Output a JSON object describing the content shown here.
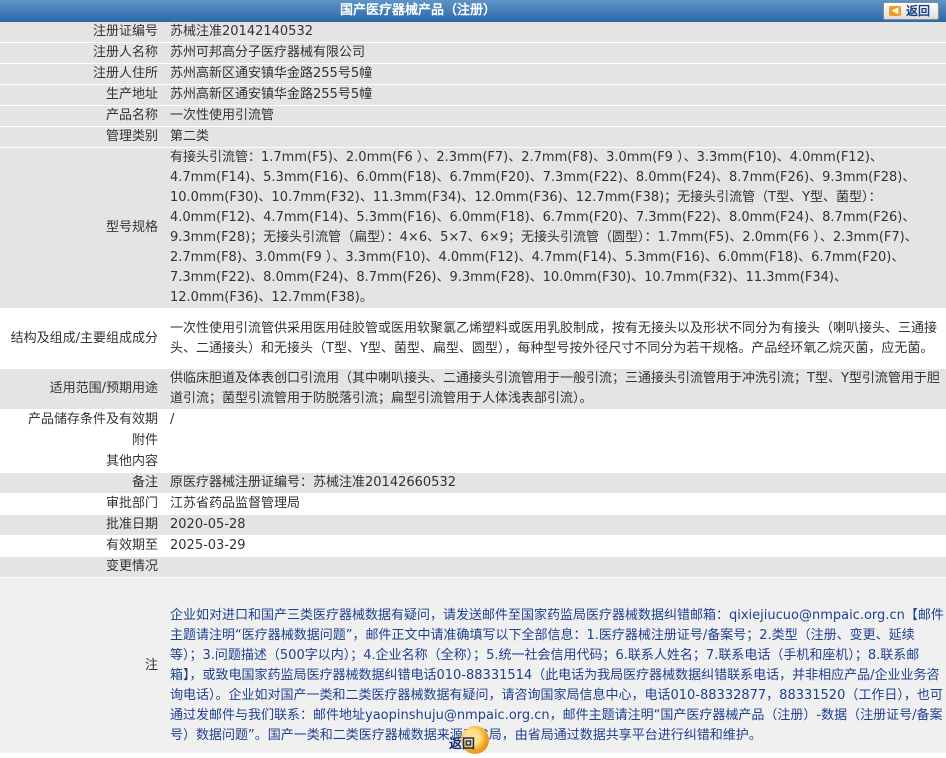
{
  "header": {
    "title": "国产医疗器械产品（注册）",
    "back_label": "返回"
  },
  "rows": [
    {
      "label": "注册证编号",
      "value": "苏械注准20142140532"
    },
    {
      "label": "注册人名称",
      "value": "苏州可邦高分子医疗器械有限公司"
    },
    {
      "label": "注册人住所",
      "value": "苏州高新区通安镇华金路255号5幢"
    },
    {
      "label": "生产地址",
      "value": "苏州高新区通安镇华金路255号5幢"
    },
    {
      "label": "产品名称",
      "value": "一次性使用引流管"
    },
    {
      "label": "管理类别",
      "value": "第二类"
    },
    {
      "label": "型号规格",
      "value": "有接头引流管：1.7mm(F5)、2.0mm(F6 ）、2.3mm(F7)、2.7mm(F8)、3.0mm(F9 ）、3.3mm(F10)、4.0mm(F12)、4.7mm(F14)、5.3mm(F16)、6.0mm(F18)、6.7mm(F20)、7.3mm(F22)、8.0mm(F24)、8.7mm(F26)、9.3mm(F28)、10.0mm(F30)、10.7mm(F32)、11.3mm(F34)、12.0mm(F36)、12.7mm(F38)；无接头引流管（T型、Y型、菌型）：4.0mm(F12)、4.7mm(F14)、5.3mm(F16)、6.0mm(F18)、6.7mm(F20)、7.3mm(F22)、8.0mm(F24)、8.7mm(F26)、9.3mm(F28)；无接头引流管（扁型）：4×6、5×7、6×9；无接头引流管（圆型）：1.7mm(F5)、2.0mm(F6 ）、2.3mm(F7)、2.7mm(F8)、3.0mm(F9 ）、3.3mm(F10)、4.0mm(F12)、4.7mm(F14)、5.3mm(F16)、6.0mm(F18)、6.7mm(F20)、7.3mm(F22)、8.0mm(F24)、8.7mm(F26)、9.3mm(F28)、10.0mm(F30)、10.7mm(F32)、11.3mm(F34)、12.0mm(F36)、12.7mm(F38)。"
    },
    {
      "label": "结构及组成/主要组成成分",
      "value": "一次性使用引流管供采用医用硅胶管或医用软聚氯乙烯塑料或医用乳胶制成，按有无接头以及形状不同分为有接头（喇叭接头、三通接头、二通接头）和无接头（T型、Y型、菌型、扁型、圆型），每种型号按外径尺寸不同分为若干规格。产品经环氧乙烷灭菌，应无菌。"
    },
    {
      "label": "适用范围/预期用途",
      "value": "供临床胆道及体表创口引流用（其中喇叭接头、二通接头引流管用于一般引流；三通接头引流管用于冲洗引流；T型、Y型引流管用于胆道引流；菌型引流管用于防脱落引流；扁型引流管用于人体浅表部引流）。"
    },
    {
      "label": "产品储存条件及有效期",
      "value": "/"
    },
    {
      "label": "附件",
      "value": ""
    },
    {
      "label": "其他内容",
      "value": ""
    },
    {
      "label": "备注",
      "value": "原医疗器械注册证编号：苏械注准20142660532"
    },
    {
      "label": "审批部门",
      "value": "江苏省药品监督管理局"
    },
    {
      "label": "批准日期",
      "value": "2020-05-28"
    },
    {
      "label": "有效期至",
      "value": "2025-03-29"
    },
    {
      "label": "变更情况",
      "value": ""
    }
  ],
  "note": {
    "label": "注",
    "value": "企业如对进口和国产三类医疗器械数据有疑问，请发送邮件至国家药监局医疗器械数据纠错邮箱：qixiejiucuo@nmpaic.org.cn【邮件主题请注明“医疗器械数据问题”，邮件正文中请准确填写以下全部信息：1.医疗器械注册证号/备案号；2.类型（注册、变更、延续等）；3.问题描述（500字以内）；4.企业名称（全称）；5.统一社会信用代码；6.联系人姓名；7.联系电话（手机和座机）；8.联系邮箱】，或致电国家药监局医疗器械数据纠错电话010-88331514（此电话为我局医疗器械数据纠错联系电话，并非相应产品/企业业务咨询电话）。企业如对国产一类和二类医疗器械数据有疑问，请咨询国家局信息中心，电话010-88332877，88331520（工作日），也可通过发邮件与我们联系：邮件地址yaopinshuju@nmpaic.org.cn，邮件主题请注明“国产医疗器械产品（注册）-数据（注册证号/备案号）数据问题”。国产一类和二类医疗器械数据来源于省局，由省局通过数据共享平台进行纠错和维护。"
  },
  "footer": {
    "back_label": "返回"
  }
}
